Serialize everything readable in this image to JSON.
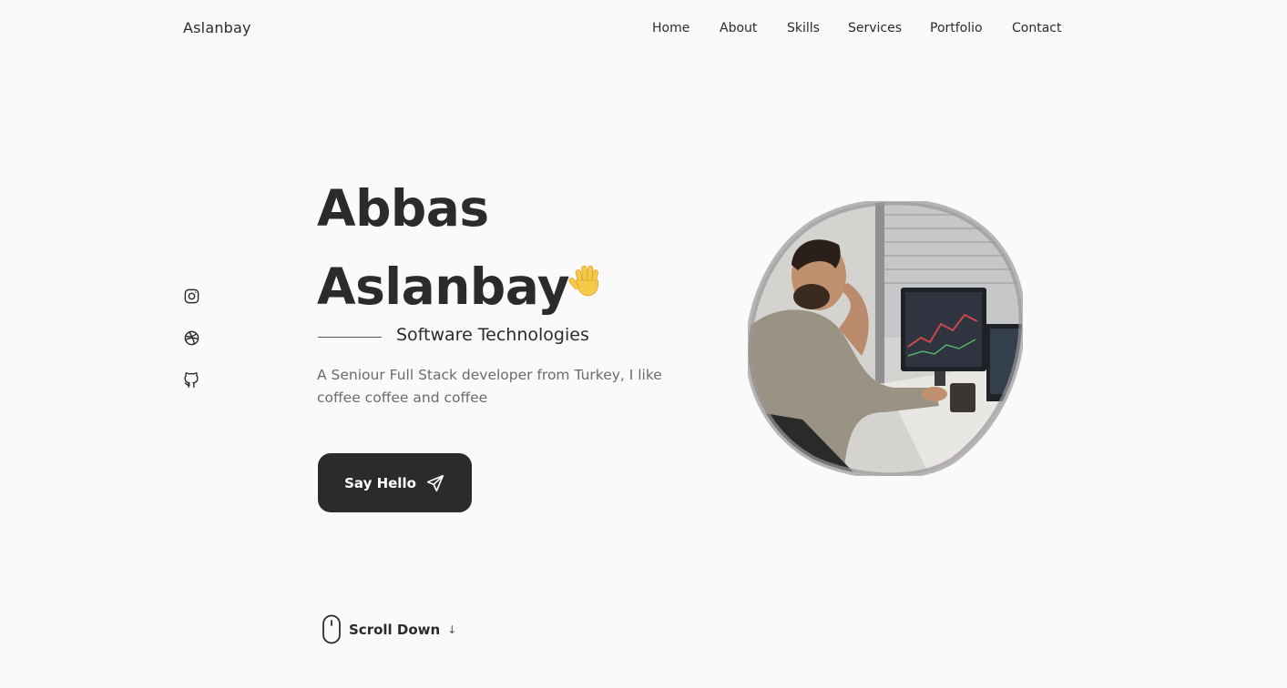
{
  "header": {
    "logo": "Aslanbay",
    "nav": [
      {
        "label": "Home"
      },
      {
        "label": "About"
      },
      {
        "label": "Skills"
      },
      {
        "label": "Services"
      },
      {
        "label": "Portfolio"
      },
      {
        "label": "Contact"
      }
    ]
  },
  "social": [
    {
      "icon": "instagram-icon"
    },
    {
      "icon": "dribbble-icon"
    },
    {
      "icon": "github-icon"
    }
  ],
  "hero": {
    "first_name": "Abbas",
    "last_name": "Aslanbay",
    "wave_icon": "waving-hand-icon",
    "subtitle": "Software Technologies",
    "description": "A Seniour Full Stack developer from Turkey, I like coffee coffee and coffee",
    "button_label": "Say Hello",
    "button_icon": "send-icon",
    "scroll_label": "Scroll Down"
  },
  "colors": {
    "background": "#fafafa",
    "text": "#2b2b2b",
    "muted": "#6b6b6b",
    "button": "#2b2b2b"
  }
}
